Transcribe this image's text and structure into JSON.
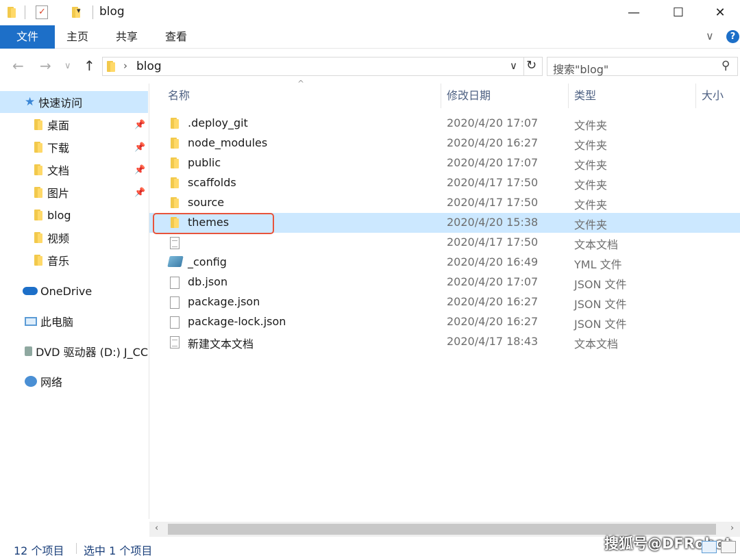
{
  "window": {
    "title": "blog",
    "minimize": "—",
    "maximize": "☐",
    "close": "✕"
  },
  "ribbon": {
    "tabs": [
      "文件",
      "主页",
      "共享",
      "查看"
    ],
    "help": "?"
  },
  "address": {
    "path": "blog",
    "search_placeholder": "搜索\"blog\""
  },
  "sidebar": {
    "quick_access": "快速访问",
    "items": [
      {
        "label": "桌面",
        "pinned": true,
        "icon": "desktop-folder-icon"
      },
      {
        "label": "下载",
        "pinned": true,
        "icon": "download-folder-icon"
      },
      {
        "label": "文档",
        "pinned": true,
        "icon": "documents-folder-icon"
      },
      {
        "label": "图片",
        "pinned": true,
        "icon": "pictures-folder-icon"
      },
      {
        "label": "blog",
        "pinned": false,
        "icon": "folder-icon"
      },
      {
        "label": "视频",
        "pinned": false,
        "icon": "videos-folder-icon"
      },
      {
        "label": "音乐",
        "pinned": false,
        "icon": "music-folder-icon"
      }
    ],
    "onedrive": "OneDrive",
    "this_pc": "此电脑",
    "dvd": "DVD 驱动器 (D:) J_CC",
    "network": "网络"
  },
  "columns": {
    "name": "名称",
    "date": "修改日期",
    "type": "类型",
    "size": "大小"
  },
  "files": [
    {
      "name": ".deploy_git",
      "date": "2020/4/20 17:07",
      "type": "文件夹",
      "kind": "folder"
    },
    {
      "name": "node_modules",
      "date": "2020/4/20 16:27",
      "type": "文件夹",
      "kind": "folder"
    },
    {
      "name": "public",
      "date": "2020/4/20 17:07",
      "type": "文件夹",
      "kind": "folder"
    },
    {
      "name": "scaffolds",
      "date": "2020/4/17 17:50",
      "type": "文件夹",
      "kind": "folder"
    },
    {
      "name": "source",
      "date": "2020/4/17 17:50",
      "type": "文件夹",
      "kind": "folder"
    },
    {
      "name": "themes",
      "date": "2020/4/20 15:38",
      "type": "文件夹",
      "kind": "folder",
      "selected": true
    },
    {
      "name": "",
      "date": "2020/4/17 17:50",
      "type": "文本文档",
      "kind": "text"
    },
    {
      "name": "_config",
      "date": "2020/4/20 16:49",
      "type": "YML 文件",
      "kind": "yml"
    },
    {
      "name": "db.json",
      "date": "2020/4/20 17:07",
      "type": "JSON 文件",
      "kind": "file"
    },
    {
      "name": "package.json",
      "date": "2020/4/20 16:27",
      "type": "JSON 文件",
      "kind": "file"
    },
    {
      "name": "package-lock.json",
      "date": "2020/4/20 16:27",
      "type": "JSON 文件",
      "kind": "file"
    },
    {
      "name": "新建文本文档",
      "date": "2020/4/17 18:43",
      "type": "文本文档",
      "kind": "text"
    }
  ],
  "status": {
    "count": "12 个项目",
    "selected": "选中 1 个项目"
  },
  "watermark": "搜狐号@DFRobot",
  "colors": {
    "accent": "#1d6fc8",
    "selection": "#cce8ff",
    "highlight_box": "#e8533a"
  }
}
